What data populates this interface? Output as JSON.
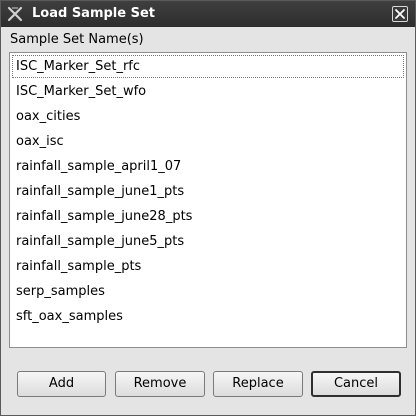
{
  "window": {
    "title": "Load Sample Set",
    "app_icon": "x-logo-icon",
    "close_icon": "close-icon"
  },
  "section": {
    "label": "Sample Set Name(s)"
  },
  "list": {
    "items": [
      "ISC_Marker_Set_rfc",
      "ISC_Marker_Set_wfo",
      "oax_cities",
      "oax_isc",
      "rainfall_sample_april1_07",
      "rainfall_sample_june1_pts",
      "rainfall_sample_june28_pts",
      "rainfall_sample_june5_pts",
      "rainfall_sample_pts",
      "serp_samples",
      "sft_oax_samples"
    ],
    "focused_index": 0
  },
  "buttons": {
    "add": "Add",
    "remove": "Remove",
    "replace": "Replace",
    "cancel": "Cancel"
  }
}
